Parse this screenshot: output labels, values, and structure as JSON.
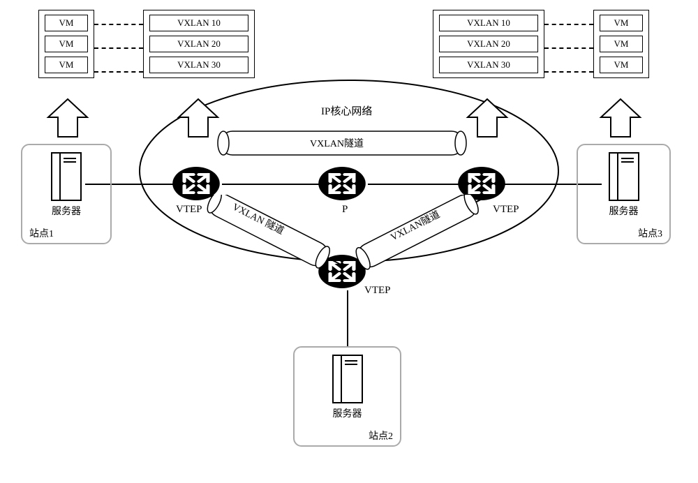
{
  "labels": {
    "core_network": "IP核心网络",
    "tunnel_top": "VXLAN隧道",
    "tunnel_left": "VXLAN 隧道",
    "tunnel_right": "VXLAN隧道",
    "vtep": "VTEP",
    "p_router": "P",
    "server": "服务器"
  },
  "sites": {
    "s1": "站点1",
    "s2": "站点2",
    "s3": "站点3"
  },
  "left_stack": {
    "vm": "VM",
    "vxlan10": "VXLAN 10",
    "vxlan20": "VXLAN 20",
    "vxlan30": "VXLAN 30"
  },
  "right_stack": {
    "vm": "VM",
    "vxlan10": "VXLAN 10",
    "vxlan20": "VXLAN 20",
    "vxlan30": "VXLAN 30"
  }
}
